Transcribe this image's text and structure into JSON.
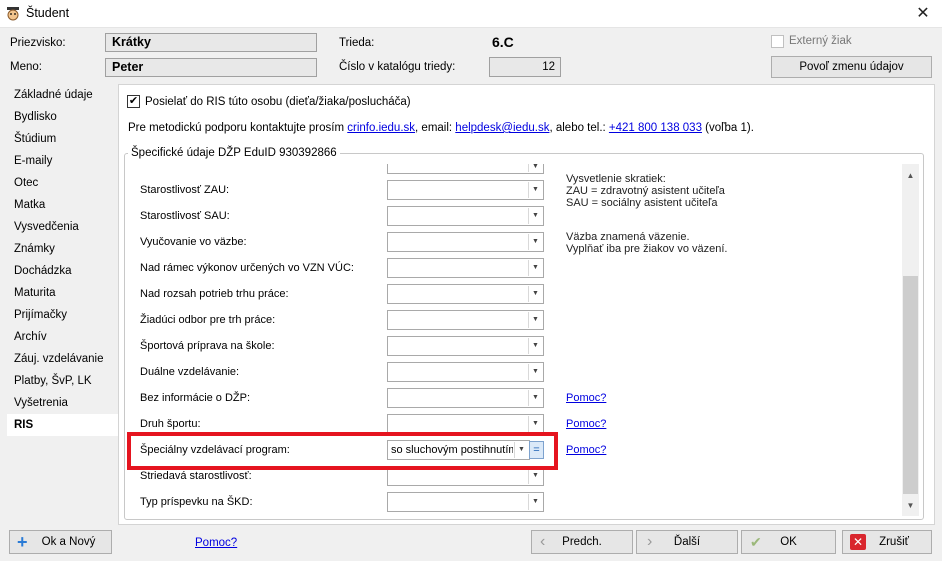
{
  "window": {
    "title": "Študent",
    "close_label": "✕"
  },
  "header": {
    "surname_label": "Priezvisko:",
    "surname_value": "Krátky",
    "name_label": "Meno:",
    "name_value": "Peter",
    "class_label": "Trieda:",
    "class_value": "6.C",
    "catalog_label": "Číslo v katalógu triedy:",
    "catalog_value": "12",
    "external_label": "Externý žiak",
    "allow_edit_button": "Povoľ zmenu údajov"
  },
  "sidebar": {
    "items": [
      {
        "label": "Základné údaje"
      },
      {
        "label": "Bydlisko"
      },
      {
        "label": "Štúdium"
      },
      {
        "label": "E-maily"
      },
      {
        "label": "Otec"
      },
      {
        "label": "Matka"
      },
      {
        "label": "Vysvedčenia"
      },
      {
        "label": "Známky"
      },
      {
        "label": "Dochádzka"
      },
      {
        "label": "Maturita"
      },
      {
        "label": "Prijímačky"
      },
      {
        "label": "Archív"
      },
      {
        "label": "Záuj. vzdelávanie"
      },
      {
        "label": "Platby, ŠvP, LK"
      },
      {
        "label": "Vyšetrenia"
      },
      {
        "label": "RIS"
      }
    ],
    "active": "RIS"
  },
  "ris": {
    "send_checkbox_label": "Posielať do RIS túto osobu (dieťa/žiaka/poslucháča)",
    "support_prefix": "Pre metodickú podporu kontaktujte prosím ",
    "support_link1": "crinfo.iedu.sk",
    "support_mid": ", email: ",
    "support_link2": "helpdesk@iedu.sk",
    "support_mid2": ", alebo tel.: ",
    "support_link3": "+421 800 138 033",
    "support_suffix": " (voľba 1).",
    "group_title": "Špecifické údaje DŽP EduID 930392866",
    "rows": [
      {
        "label": "Starostlivosť ZAU:",
        "value": "",
        "help": ""
      },
      {
        "label": "Starostlivosť SAU:",
        "value": "",
        "help": ""
      },
      {
        "label": "Vyučovanie vo väzbe:",
        "value": "",
        "help": ""
      },
      {
        "label": "Nad rámec výkonov určených vo VZN VÚC:",
        "value": "",
        "help": ""
      },
      {
        "label": "Nad rozsah potrieb trhu práce:",
        "value": "",
        "help": ""
      },
      {
        "label": "Žiadúci odbor pre trh práce:",
        "value": "",
        "help": ""
      },
      {
        "label": "Športová príprava na škole:",
        "value": "",
        "help": ""
      },
      {
        "label": "Duálne vzdelávanie:",
        "value": "",
        "help": ""
      },
      {
        "label": "Bez informácie o DŽP:",
        "value": "",
        "help": "Pomoc?"
      },
      {
        "label": "Druh športu:",
        "value": "",
        "help": "Pomoc?"
      },
      {
        "label": "Špeciálny vzdelávací program:",
        "value": "so sluchovým postihnutím",
        "help": "Pomoc?"
      },
      {
        "label": "Striedavá starostlivosť:",
        "value": "",
        "help": ""
      },
      {
        "label": "Typ príspevku na ŠKD:",
        "value": "",
        "help": ""
      }
    ],
    "equals_button": "=",
    "note1": [
      "Vysvetlenie skratiek:",
      "ZAU = zdravotný asistent učiteľa",
      "SAU = sociálny asistent učiteľa"
    ],
    "note2": [
      "Väzba znamená väzenie.",
      "Vyplňať iba pre žiakov vo väzení."
    ]
  },
  "footer": {
    "ok_new": "Ok a Nový",
    "help": "Pomoc?",
    "prev": "Predch.",
    "next": "Ďalší",
    "ok": "OK",
    "cancel": "Zrušiť"
  },
  "colors": {
    "highlight": "#e5141f",
    "link": "#0000e0"
  }
}
